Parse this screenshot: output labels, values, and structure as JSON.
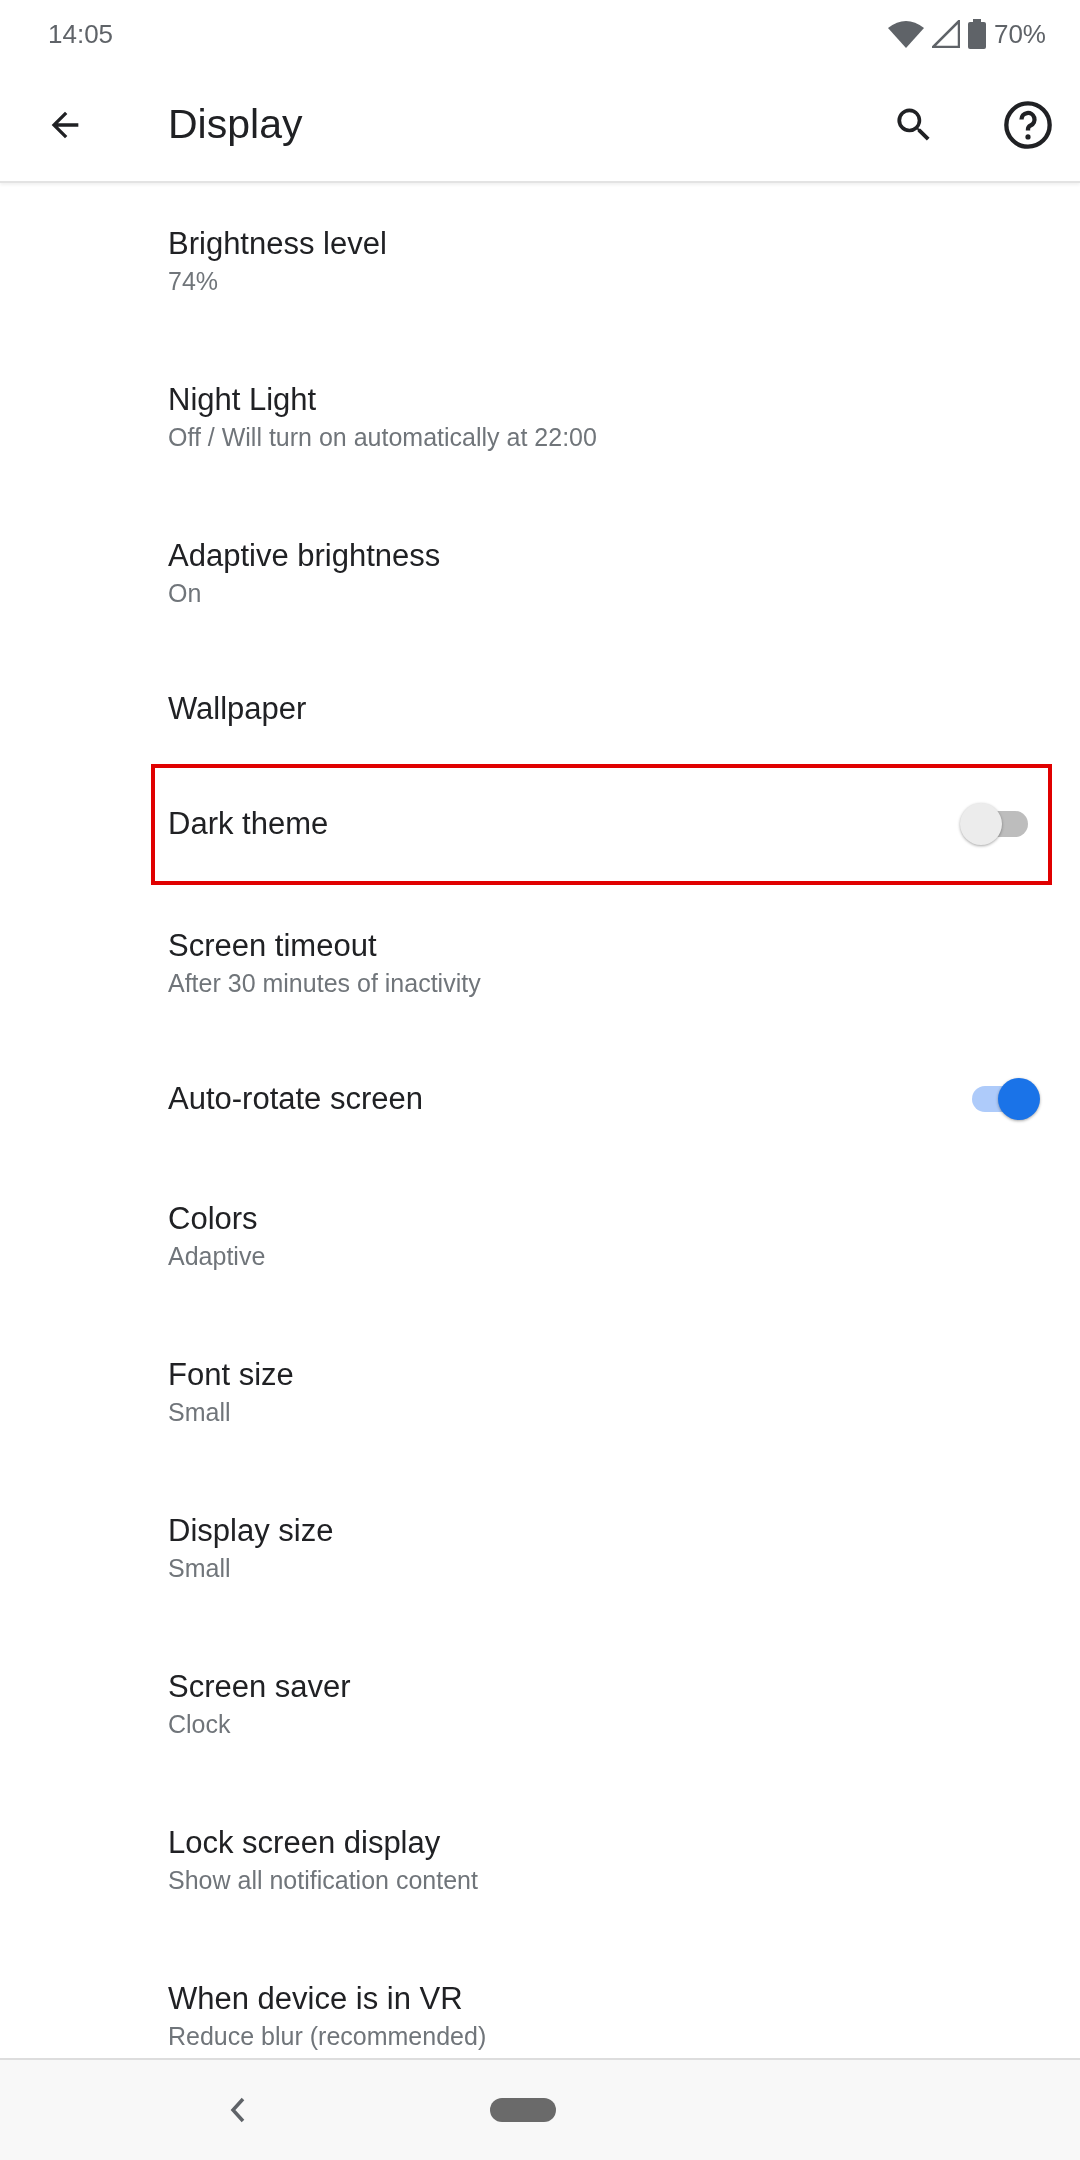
{
  "status_bar": {
    "time": "14:05",
    "battery": "70%"
  },
  "app_bar": {
    "title": "Display"
  },
  "settings": [
    {
      "kind": "text",
      "title": "Brightness level",
      "summary": "74%"
    },
    {
      "kind": "text",
      "title": "Night Light",
      "summary": "Off / Will turn on automatically at 22:00"
    },
    {
      "kind": "text",
      "title": "Adaptive brightness",
      "summary": "On"
    },
    {
      "kind": "text",
      "title": "Wallpaper"
    },
    {
      "kind": "switch",
      "title": "Dark theme",
      "on": false,
      "highlighted": true
    },
    {
      "kind": "text",
      "title": "Screen timeout",
      "summary": "After 30 minutes of inactivity"
    },
    {
      "kind": "switch",
      "title": "Auto-rotate screen",
      "on": true
    },
    {
      "kind": "text",
      "title": "Colors",
      "summary": "Adaptive"
    },
    {
      "kind": "text",
      "title": "Font size",
      "summary": "Small"
    },
    {
      "kind": "text",
      "title": "Display size",
      "summary": "Small"
    },
    {
      "kind": "text",
      "title": "Screen saver",
      "summary": "Clock"
    },
    {
      "kind": "text",
      "title": "Lock screen display",
      "summary": "Show all notification content"
    },
    {
      "kind": "text",
      "title": "When device is in VR",
      "summary": "Reduce blur (recommended)"
    }
  ]
}
